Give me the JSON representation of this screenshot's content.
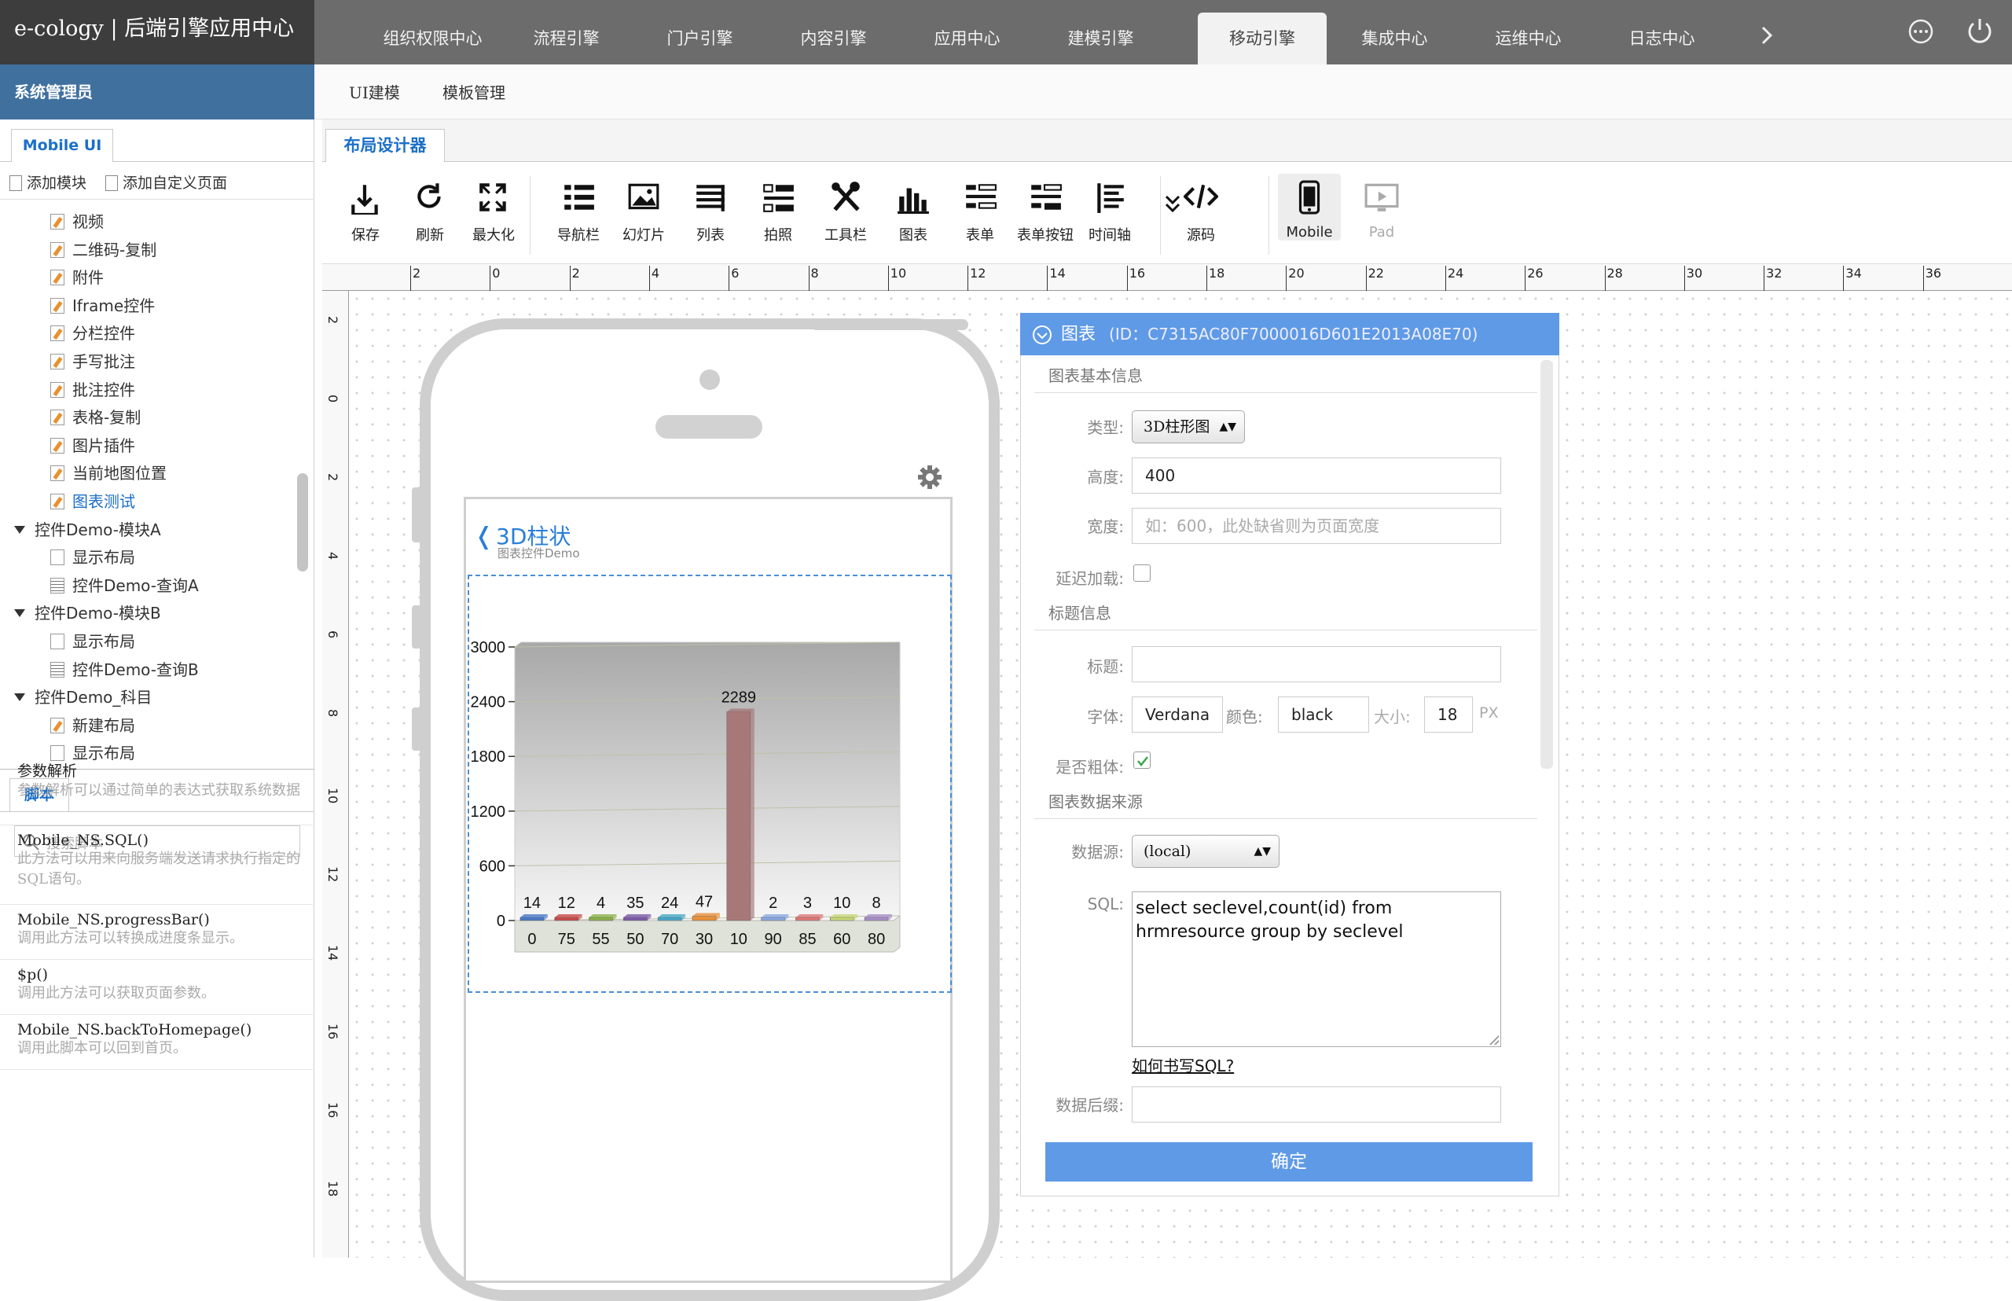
{
  "app": {
    "title": "e-cology | 后端引擎应用中心"
  },
  "topnav": {
    "items": [
      "组织权限中心",
      "流程引擎",
      "门户引擎",
      "内容引擎",
      "应用中心",
      "建模引擎",
      "移动引擎",
      "集成中心",
      "运维中心",
      "日志中心"
    ],
    "active": "移动引擎",
    "more_icon": "chevron-right-icon",
    "menu_icon": "more-icon",
    "power_icon": "power-icon"
  },
  "subnav": {
    "items": [
      "UI建模",
      "模板管理"
    ]
  },
  "sidebar": {
    "user": "系统管理员",
    "tab": "Mobile UI",
    "actions": {
      "add_module": "添加模块",
      "add_custom_page": "添加自定义页面"
    },
    "tree": [
      {
        "label": "视频",
        "type": "pen",
        "indent": 2
      },
      {
        "label": "二维码-复制",
        "type": "pen",
        "indent": 2
      },
      {
        "label": "附件",
        "type": "pen",
        "indent": 2
      },
      {
        "label": "Iframe控件",
        "type": "pen",
        "indent": 2
      },
      {
        "label": "分栏控件",
        "type": "pen",
        "indent": 2
      },
      {
        "label": "手写批注",
        "type": "pen",
        "indent": 2
      },
      {
        "label": "批注控件",
        "type": "pen",
        "indent": 2
      },
      {
        "label": "表格-复制",
        "type": "pen",
        "indent": 2
      },
      {
        "label": "图片插件",
        "type": "pen",
        "indent": 2
      },
      {
        "label": "当前地图位置",
        "type": "pen",
        "indent": 2
      },
      {
        "label": "图表测试",
        "type": "pen",
        "indent": 2,
        "selected": true
      },
      {
        "label": "控件Demo-模块A",
        "type": "folder",
        "indent": 1
      },
      {
        "label": "显示布局",
        "type": "page",
        "indent": 2
      },
      {
        "label": "控件Demo-查询A",
        "type": "grid",
        "indent": 2
      },
      {
        "label": "控件Demo-模块B",
        "type": "folder",
        "indent": 1
      },
      {
        "label": "显示布局",
        "type": "page",
        "indent": 2
      },
      {
        "label": "控件Demo-查询B",
        "type": "grid",
        "indent": 2
      },
      {
        "label": "控件Demo_科目",
        "type": "folder",
        "indent": 1
      },
      {
        "label": "新建布局",
        "type": "pen",
        "indent": 2
      },
      {
        "label": "显示布局",
        "type": "page",
        "indent": 2
      }
    ],
    "script_tab": "脚本",
    "search_placeholder": "搜索脚本",
    "scripts": [
      {
        "title": "参数解析",
        "desc": "参数解析可以通过简单的表达式获取系统数据"
      },
      {
        "title": "Mobile_NS.SQL()",
        "desc": "此方法可以用来向服务端发送请求执行指定的SQL语句。"
      },
      {
        "title": "Mobile_NS.progressBar()",
        "desc": "调用此方法可以转换成进度条显示。"
      },
      {
        "title": "$p()",
        "desc": "调用此方法可以获取页面参数。"
      },
      {
        "title": "Mobile_NS.backToHomepage()",
        "desc": "调用此脚本可以回到首页。"
      }
    ]
  },
  "designer": {
    "tab": "布局设计器",
    "tools": [
      {
        "label": "保存",
        "icon": "save-icon"
      },
      {
        "label": "刷新",
        "icon": "refresh-icon"
      },
      {
        "label": "最大化",
        "icon": "maximize-icon"
      },
      {
        "label": "导航栏",
        "icon": "navbar-icon"
      },
      {
        "label": "幻灯片",
        "icon": "slideshow-icon"
      },
      {
        "label": "列表",
        "icon": "list-icon"
      },
      {
        "label": "拍照",
        "icon": "photo-icon"
      },
      {
        "label": "工具栏",
        "icon": "tools-icon"
      },
      {
        "label": "图表",
        "icon": "chart-icon"
      },
      {
        "label": "表单",
        "icon": "form-icon"
      },
      {
        "label": "表单按钮",
        "icon": "form-button-icon"
      },
      {
        "label": "时间轴",
        "icon": "timeline-icon"
      },
      {
        "label": "源码",
        "icon": "source-code-icon"
      },
      {
        "label": "Mobile",
        "icon": "mobile-icon"
      },
      {
        "label": "Pad",
        "icon": "pad-icon"
      }
    ],
    "ruler_top": [
      "2",
      "0",
      "2",
      "4",
      "6",
      "8",
      "10",
      "12",
      "14",
      "16",
      "18",
      "20",
      "22",
      "24",
      "26",
      "28",
      "30",
      "32",
      "34",
      "36"
    ],
    "ruler_left": [
      "2",
      "0",
      "2",
      "4",
      "6",
      "8",
      "10",
      "12",
      "14",
      "16",
      "16",
      "18"
    ]
  },
  "phone": {
    "page_title": "3D柱状",
    "page_subtitle": "图表控件Demo",
    "settings_icon": "gear-icon"
  },
  "chart_data": {
    "type": "bar",
    "title": "",
    "categories": [
      "0",
      "75",
      "55",
      "50",
      "70",
      "30",
      "10",
      "90",
      "85",
      "60",
      "80"
    ],
    "values": [
      14,
      12,
      4,
      35,
      24,
      47,
      2289,
      2,
      3,
      10,
      8
    ],
    "colors": [
      "#4a78c8",
      "#c84a4a",
      "#8ab04a",
      "#7a5aa8",
      "#48a8c8",
      "#e8903a",
      "#a87878",
      "#8aa8e0",
      "#e07878",
      "#c8d878",
      "#a890c8"
    ],
    "ylim": [
      0,
      3000
    ],
    "yticks": [
      "3000",
      "2400",
      "1800",
      "1200",
      "600",
      "0"
    ],
    "style": "3d"
  },
  "property_panel": {
    "header": "图表",
    "header_id": "(ID：C7315AC80F7000016D601E2013A08E70)",
    "sections": {
      "basic": "图表基本信息",
      "title": "标题信息",
      "source": "图表数据来源"
    },
    "labels": {
      "type": "类型:",
      "height": "高度:",
      "width": "宽度:",
      "lazy": "延迟加载:",
      "title": "标题:",
      "font": "字体:",
      "color": "颜色:",
      "size": "大小:",
      "bold": "是否粗体:",
      "datasource": "数据源:",
      "sql": "SQL:",
      "suffix": "数据后缀:"
    },
    "values": {
      "type": "3D柱形图",
      "height": "400",
      "width_placeholder": "如：600，此处缺省则为页面宽度",
      "title": "",
      "font": "Verdana",
      "color": "black",
      "size": "18",
      "size_unit": "PX",
      "datasource": "(local)",
      "sql": "select seclevel,count(id) from hrmresource group by seclevel",
      "suffix": ""
    },
    "lazy_checked": false,
    "bold_checked": true,
    "sql_help": "如何书写SQL?",
    "confirm": "确定"
  }
}
